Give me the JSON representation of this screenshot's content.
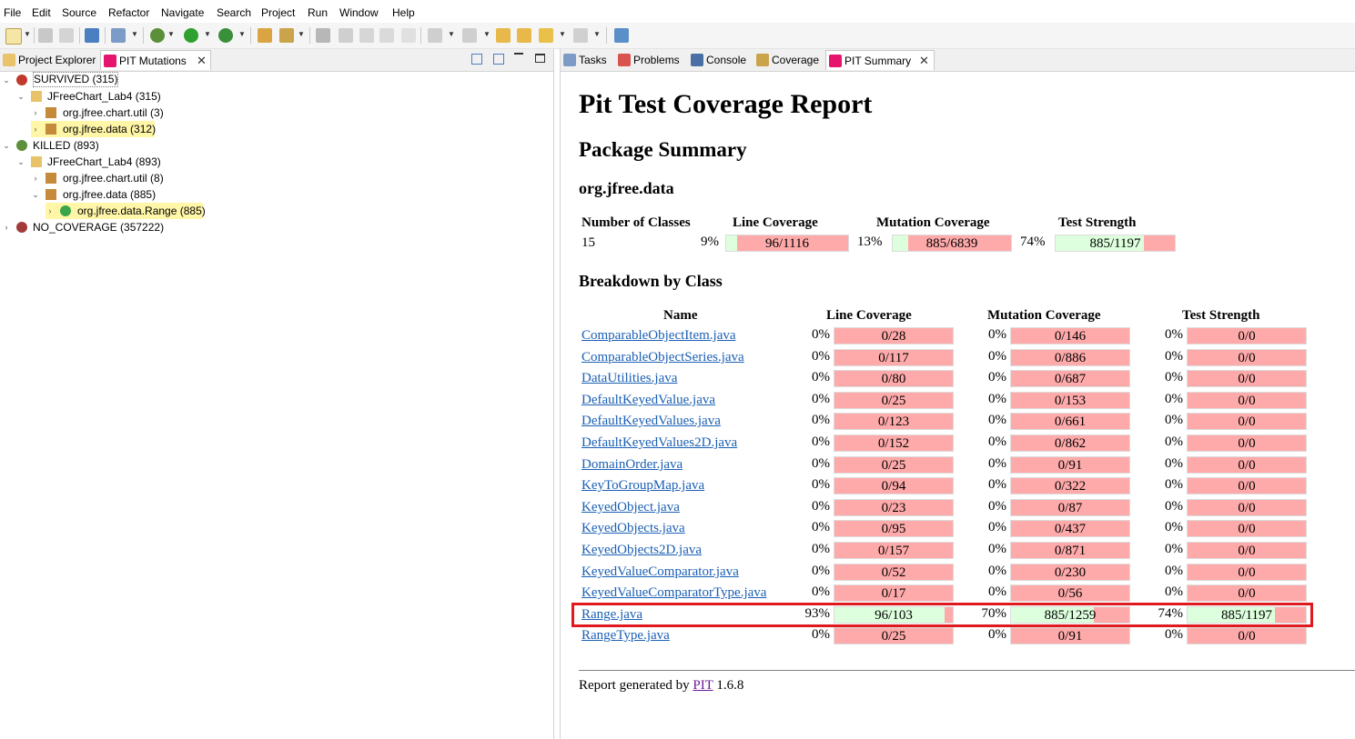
{
  "menu": [
    "File",
    "Edit",
    "Source",
    "Refactor",
    "Navigate",
    "Search",
    "Project",
    "Run",
    "Window",
    "Help"
  ],
  "left_tabs": {
    "project_explorer": "Project Explorer",
    "pit_mutations": "PIT Mutations"
  },
  "tree": {
    "survived": "SURVIVED (315)",
    "survived_project": "JFreeChart_Lab4 (315)",
    "survived_util": "org.jfree.chart.util (3)",
    "survived_data": "org.jfree.data (312)",
    "killed": "KILLED (893)",
    "killed_project": "JFreeChart_Lab4 (893)",
    "killed_util": "org.jfree.chart.util (8)",
    "killed_data": "org.jfree.data (885)",
    "killed_range": "org.jfree.data.Range (885)",
    "no_coverage": "NO_COVERAGE (357222)"
  },
  "right_tabs": {
    "tasks": "Tasks",
    "problems": "Problems",
    "console": "Console",
    "coverage": "Coverage",
    "pit_summary": "PIT Summary"
  },
  "report": {
    "title": "Pit Test Coverage Report",
    "package_summary": "Package Summary",
    "package_name": "org.jfree.data",
    "summary_headers": {
      "classes": "Number of Classes",
      "line": "Line Coverage",
      "mutation": "Mutation Coverage",
      "strength": "Test Strength"
    },
    "summary": {
      "classes": "15",
      "line_pct": "9%",
      "line_text": "96/1116",
      "line_frac": 0.086,
      "mut_pct": "13%",
      "mut_text": "885/6839",
      "mut_frac": 0.129,
      "str_pct": "74%",
      "str_text": "885/1197",
      "str_frac": 0.739
    },
    "breakdown_title": "Breakdown by Class",
    "breakdown_headers": {
      "name": "Name",
      "line": "Line Coverage",
      "mutation": "Mutation Coverage",
      "strength": "Test Strength"
    },
    "classes": [
      {
        "name": "ComparableObjectItem.java",
        "line_pct": "0%",
        "line": "0/28",
        "line_frac": 0,
        "mut_pct": "0%",
        "mut": "0/146",
        "mut_frac": 0,
        "str_pct": "0%",
        "str": "0/0",
        "str_frac": 0
      },
      {
        "name": "ComparableObjectSeries.java",
        "line_pct": "0%",
        "line": "0/117",
        "line_frac": 0,
        "mut_pct": "0%",
        "mut": "0/886",
        "mut_frac": 0,
        "str_pct": "0%",
        "str": "0/0",
        "str_frac": 0
      },
      {
        "name": "DataUtilities.java",
        "line_pct": "0%",
        "line": "0/80",
        "line_frac": 0,
        "mut_pct": "0%",
        "mut": "0/687",
        "mut_frac": 0,
        "str_pct": "0%",
        "str": "0/0",
        "str_frac": 0
      },
      {
        "name": "DefaultKeyedValue.java",
        "line_pct": "0%",
        "line": "0/25",
        "line_frac": 0,
        "mut_pct": "0%",
        "mut": "0/153",
        "mut_frac": 0,
        "str_pct": "0%",
        "str": "0/0",
        "str_frac": 0
      },
      {
        "name": "DefaultKeyedValues.java",
        "line_pct": "0%",
        "line": "0/123",
        "line_frac": 0,
        "mut_pct": "0%",
        "mut": "0/661",
        "mut_frac": 0,
        "str_pct": "0%",
        "str": "0/0",
        "str_frac": 0
      },
      {
        "name": "DefaultKeyedValues2D.java",
        "line_pct": "0%",
        "line": "0/152",
        "line_frac": 0,
        "mut_pct": "0%",
        "mut": "0/862",
        "mut_frac": 0,
        "str_pct": "0%",
        "str": "0/0",
        "str_frac": 0
      },
      {
        "name": "DomainOrder.java",
        "line_pct": "0%",
        "line": "0/25",
        "line_frac": 0,
        "mut_pct": "0%",
        "mut": "0/91",
        "mut_frac": 0,
        "str_pct": "0%",
        "str": "0/0",
        "str_frac": 0
      },
      {
        "name": "KeyToGroupMap.java",
        "line_pct": "0%",
        "line": "0/94",
        "line_frac": 0,
        "mut_pct": "0%",
        "mut": "0/322",
        "mut_frac": 0,
        "str_pct": "0%",
        "str": "0/0",
        "str_frac": 0
      },
      {
        "name": "KeyedObject.java",
        "line_pct": "0%",
        "line": "0/23",
        "line_frac": 0,
        "mut_pct": "0%",
        "mut": "0/87",
        "mut_frac": 0,
        "str_pct": "0%",
        "str": "0/0",
        "str_frac": 0
      },
      {
        "name": "KeyedObjects.java",
        "line_pct": "0%",
        "line": "0/95",
        "line_frac": 0,
        "mut_pct": "0%",
        "mut": "0/437",
        "mut_frac": 0,
        "str_pct": "0%",
        "str": "0/0",
        "str_frac": 0
      },
      {
        "name": "KeyedObjects2D.java",
        "line_pct": "0%",
        "line": "0/157",
        "line_frac": 0,
        "mut_pct": "0%",
        "mut": "0/871",
        "mut_frac": 0,
        "str_pct": "0%",
        "str": "0/0",
        "str_frac": 0
      },
      {
        "name": "KeyedValueComparator.java",
        "line_pct": "0%",
        "line": "0/52",
        "line_frac": 0,
        "mut_pct": "0%",
        "mut": "0/230",
        "mut_frac": 0,
        "str_pct": "0%",
        "str": "0/0",
        "str_frac": 0
      },
      {
        "name": "KeyedValueComparatorType.java",
        "line_pct": "0%",
        "line": "0/17",
        "line_frac": 0,
        "mut_pct": "0%",
        "mut": "0/56",
        "mut_frac": 0,
        "str_pct": "0%",
        "str": "0/0",
        "str_frac": 0
      },
      {
        "name": "Range.java",
        "line_pct": "93%",
        "line": "96/103",
        "line_frac": 0.932,
        "mut_pct": "70%",
        "mut": "885/1259",
        "mut_frac": 0.703,
        "str_pct": "74%",
        "str": "885/1197",
        "str_frac": 0.739
      },
      {
        "name": "RangeType.java",
        "line_pct": "0%",
        "line": "0/25",
        "line_frac": 0,
        "mut_pct": "0%",
        "mut": "0/91",
        "mut_frac": 0,
        "str_pct": "0%",
        "str": "0/0",
        "str_frac": 0
      }
    ],
    "footer_prefix": "Report generated by",
    "footer_link": "PIT",
    "footer_version": "1.6.8"
  },
  "colors": {
    "covered": "#ddffdd",
    "uncovered": "#ffaaaa",
    "highlight": "#e0191e",
    "link": "#1a5fb4",
    "pit_icon": "#e5156e"
  },
  "icons": [
    "new-file-icon",
    "save-icon",
    "save-all-icon",
    "debug-icon",
    "run-icon",
    "external-tool-icon",
    "open-type-icon",
    "search-icon",
    "back-icon",
    "forward-icon",
    "last-edit-icon",
    "new-window-icon",
    "collapse-all-icon",
    "expand-all-icon",
    "minimize-icon",
    "maximize-icon",
    "bug-icon",
    "project-folder-icon",
    "package-icon",
    "class-icon",
    "tasks-icon",
    "problems-icon",
    "console-icon",
    "coverage-icon",
    "pit-icon",
    "close-icon"
  ]
}
